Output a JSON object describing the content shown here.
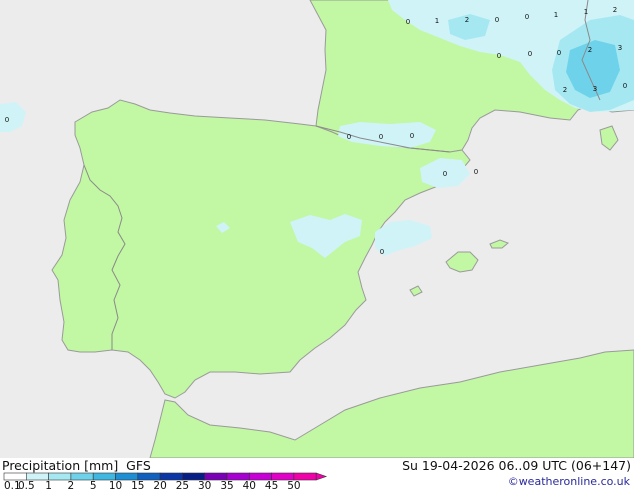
{
  "footer": {
    "title": "Precipitation [mm]  GFS",
    "datetime": "Su 19-04-2026 06..09 UTC (06+147)",
    "credit": "©weatheronline.co.uk"
  },
  "legend": {
    "ticks": [
      "0.1",
      "0.5",
      "1",
      "2",
      "5",
      "10",
      "15",
      "20",
      "25",
      "30",
      "35",
      "40",
      "45",
      "50"
    ],
    "colors": [
      "#ffffff",
      "#d0f3f8",
      "#a6e8f2",
      "#6ed3ea",
      "#3fb7e0",
      "#1f8fd4",
      "#1060c0",
      "#0a36a8",
      "#061e86",
      "#7a00b8",
      "#a600d2",
      "#c800d8",
      "#e000c8",
      "#f000a8"
    ]
  },
  "map_style": {
    "sea": "#ececec",
    "land": "#c2f7a3",
    "border": "#8a8a8a",
    "coast": "#9a9a9a"
  },
  "value_labels": [
    {
      "text": "0"
    },
    {
      "text": "1"
    },
    {
      "text": "2"
    },
    {
      "text": "0"
    },
    {
      "text": "0"
    },
    {
      "text": "1"
    },
    {
      "text": "1"
    },
    {
      "text": "2"
    },
    {
      "text": "0"
    },
    {
      "text": "0"
    },
    {
      "text": "0"
    },
    {
      "text": "2"
    },
    {
      "text": "3"
    },
    {
      "text": "2"
    },
    {
      "text": "3"
    },
    {
      "text": "0"
    },
    {
      "text": "0"
    },
    {
      "text": "0"
    },
    {
      "text": "0"
    },
    {
      "text": "0"
    },
    {
      "text": "0"
    },
    {
      "text": "0"
    },
    {
      "text": "0"
    }
  ]
}
